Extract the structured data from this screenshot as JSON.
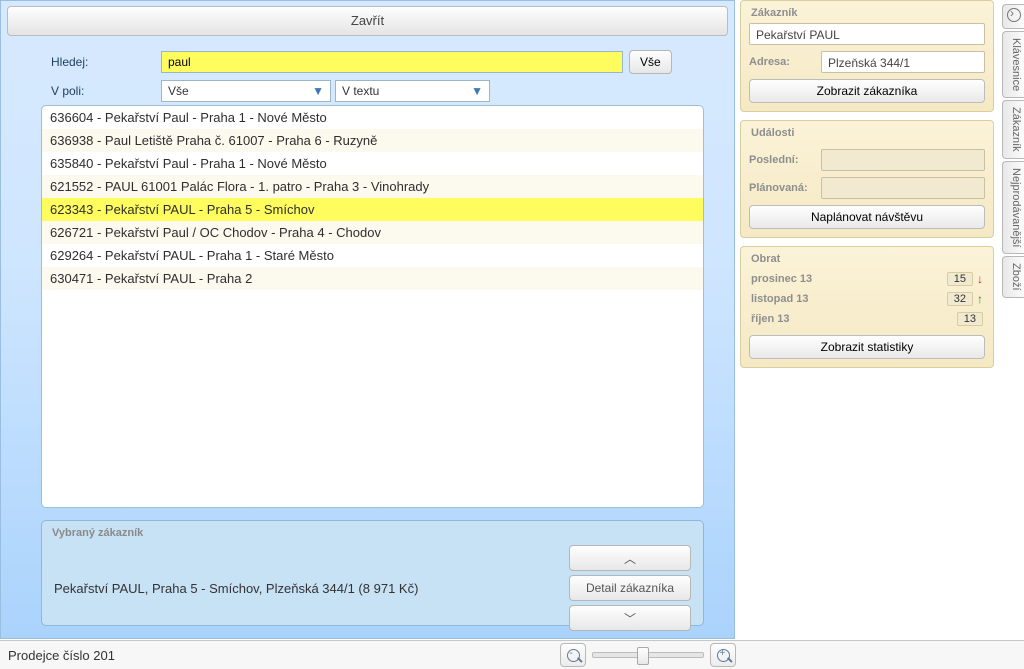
{
  "close_label": "Zavřít",
  "search": {
    "label": "Hledej:",
    "value": "paul",
    "all_button": "Vše",
    "field_label": "V poli:",
    "combo_field": "Vše",
    "combo_where": "V textu"
  },
  "results": [
    "636604 - Pekařství Paul - Praha 1 - Nové Město",
    "636938 - Paul Letiště Praha č. 61007 - Praha 6 - Ruzyně",
    "635840 - Pekařství Paul - Praha 1 - Nové Město",
    "621552 - PAUL 61001 Palác Flora - 1. patro - Praha 3 - Vinohrady",
    "623343 - Pekařství PAUL - Praha 5 - Smíchov",
    "626721 - Pekařství Paul / OC Chodov - Praha 4 - Chodov",
    "629264 - Pekařství PAUL - Praha 1 - Staré Město",
    "630471 - Pekařství PAUL - Praha 2"
  ],
  "results_selected_index": 4,
  "selected": {
    "section_title": "Vybraný zákazník",
    "text": "Pekařství PAUL, Praha 5 - Smíchov, Plzeňská 344/1 (8 971 Kč)",
    "detail_button": "Detail zákazníka"
  },
  "right": {
    "customer": {
      "title": "Zákazník",
      "name": "Pekařství PAUL",
      "address_label": "Adresa:",
      "address": "Plzeňská 344/1",
      "show_button": "Zobrazit zákazníka"
    },
    "events": {
      "title": "Události",
      "last_label": "Poslední:",
      "last_value": "",
      "planned_label": "Plánovaná:",
      "planned_value": "",
      "plan_button": "Naplánovat návštěvu"
    },
    "turnover": {
      "title": "Obrat",
      "rows": [
        {
          "month": "prosinec 13",
          "value": "15",
          "dir": "down"
        },
        {
          "month": "listopad 13",
          "value": "32",
          "dir": "up"
        },
        {
          "month": "říjen 13",
          "value": "13",
          "dir": ""
        }
      ],
      "stats_button": "Zobrazit statistiky"
    }
  },
  "side_tabs": [
    "Klávesnice",
    "Zákazník",
    "Nejprodávanější",
    "Zboží"
  ],
  "status": {
    "seller_text": "Prodejce číslo 201"
  }
}
